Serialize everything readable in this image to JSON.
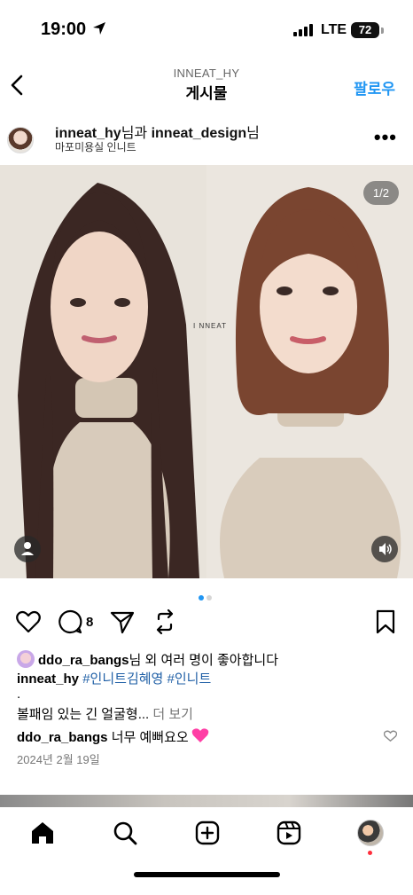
{
  "status_bar": {
    "time": "19:00",
    "network": "LTE",
    "battery": "72"
  },
  "header": {
    "account": "INNEAT_HY",
    "title": "게시물",
    "follow_label": "팔로우"
  },
  "post": {
    "user_primary": "inneat_hy",
    "user_joiner": "님과 ",
    "user_secondary": "inneat_design",
    "user_suffix": "님",
    "location": "마포미용실 인니트",
    "image_counter": "1/2",
    "watermark": "I NNEAT",
    "comment_count": "8",
    "likes": {
      "user": "ddo_ra_bangs",
      "text": "님 외 여러 명이 좋아합니다"
    },
    "caption": {
      "user": "inneat_hy",
      "hashtags": "#인니트김혜영 #인니트",
      "dot": ".",
      "text": "볼패임 있는 긴 얼굴형...",
      "more": " 더 보기"
    },
    "top_comment": {
      "user": "ddo_ra_bangs",
      "text": "너무 예뻐요오"
    },
    "date": "2024년 2월 19일"
  },
  "colors": {
    "accent_blue": "#2196f3",
    "hashtag_blue": "#1f5fa6",
    "carousel_active": "#2196f3",
    "carousel_inactive": "#d6d6d6",
    "notification_red": "#ff2d3b"
  },
  "icons": {
    "back": "chevron-left-icon",
    "more": "more-horizontal-icon",
    "like": "heart-icon",
    "comment": "comment-icon",
    "share": "send-icon",
    "repost": "repost-icon",
    "save": "bookmark-icon",
    "tag": "person-tag-icon",
    "sound": "speaker-icon",
    "home": "home-icon",
    "search": "search-icon",
    "create": "plus-square-icon",
    "reels": "reels-icon"
  }
}
